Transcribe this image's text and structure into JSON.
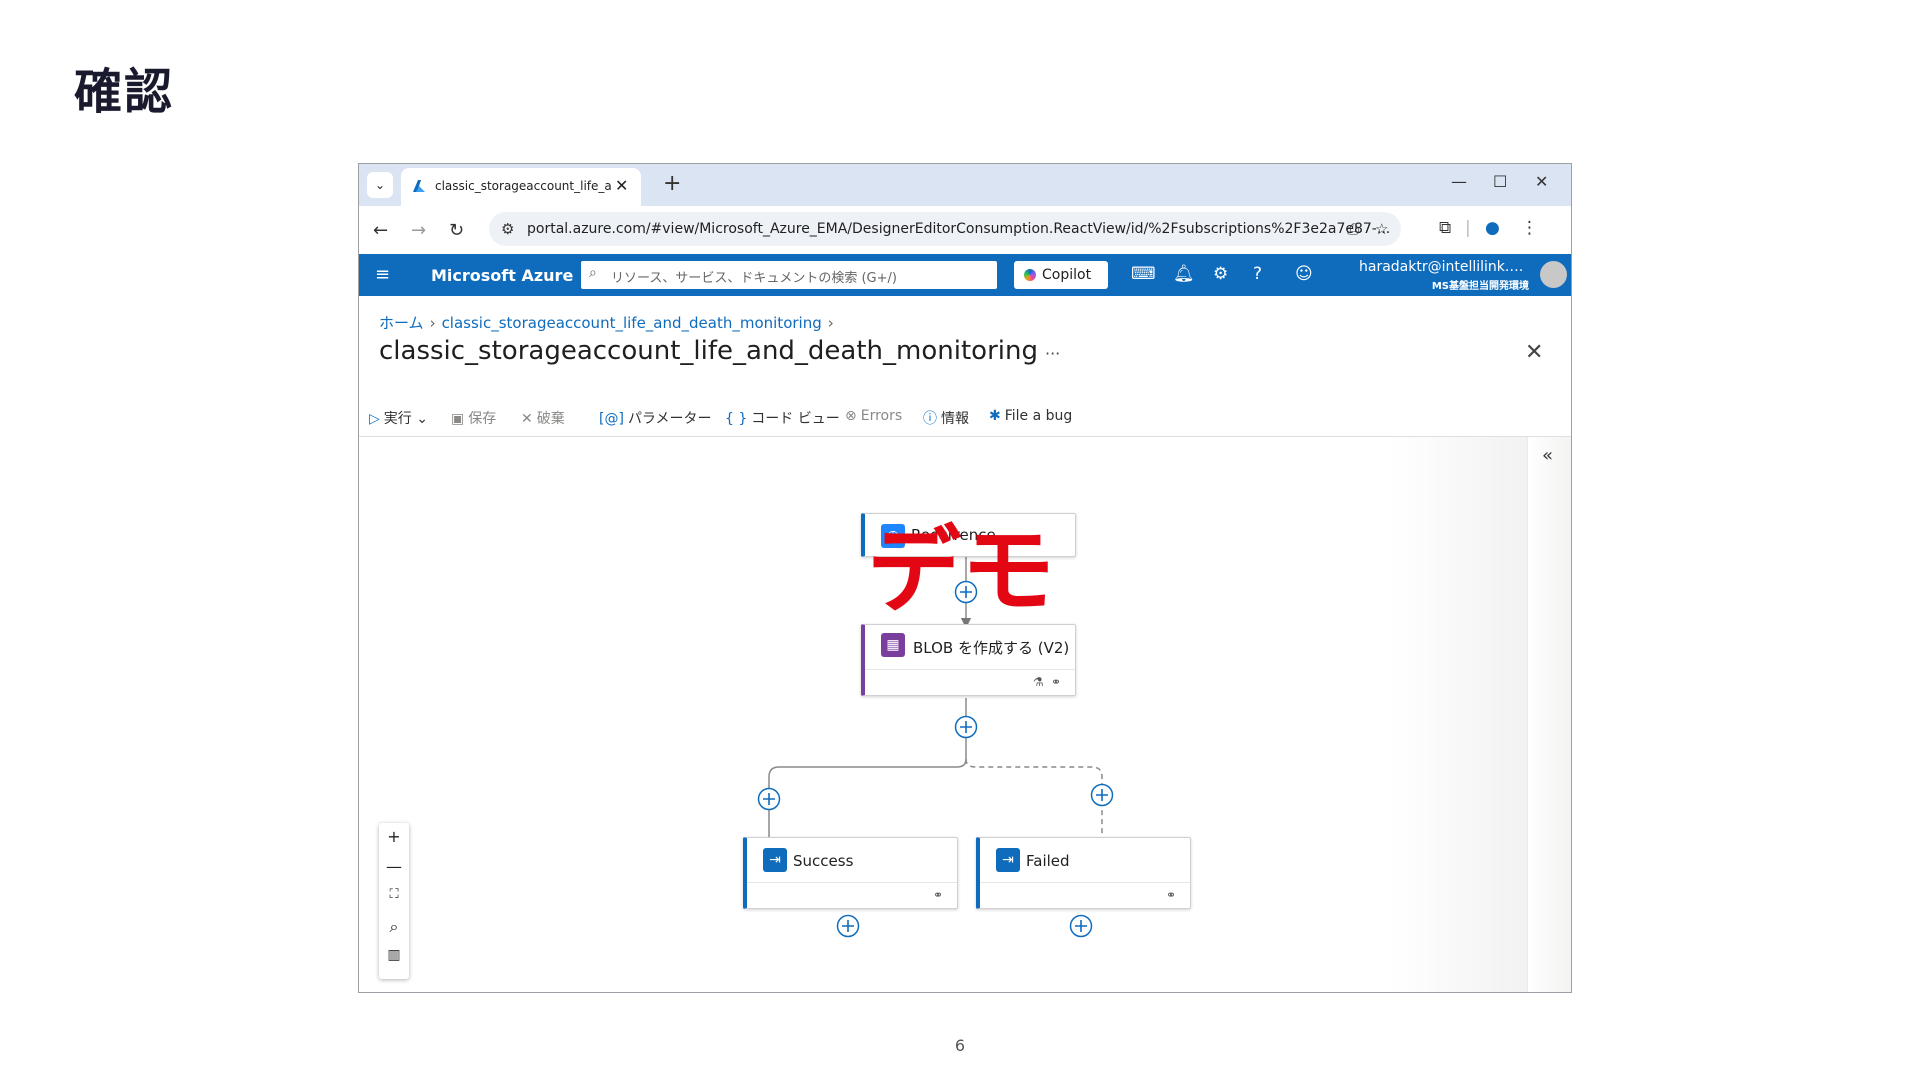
{
  "slide": {
    "title": "確認",
    "page_number": "6"
  },
  "browser": {
    "tab_title": "classic_storageaccount_life_and_death_monitoring",
    "tab_close": "✕",
    "new_tab": "+",
    "url": "portal.azure.com/#view/Microsoft_Azure_EMA/DesignerEditorConsumption.ReactView/id/%2Fsubscriptions%2F3e2a7e87-..."
  },
  "azure": {
    "brand": "Microsoft Azure",
    "search_placeholder": "リソース、サービス、ドキュメントの検索 (G+/)",
    "copilot": "Copilot",
    "user_name": "haradaktr@intellilink.…",
    "user_tenant": "MS基盤担当開発環境"
  },
  "breadcrumb": {
    "home": "ホーム",
    "resource": "classic_storageaccount_life_and_death_monitoring"
  },
  "page_title": "classic_storageaccount_life_and_death_monitoring",
  "more": "···",
  "commands": {
    "run": "実行",
    "save": "保存",
    "discard": "破棄",
    "parameters": "パラメーター",
    "code_view": "コード ビュー",
    "errors": "Errors",
    "info": "情報",
    "file_bug": "File a bug"
  },
  "workflow": {
    "trigger": "Recurrence",
    "action": "BLOB を作成する (V2)",
    "branch_success": "Success",
    "branch_failed": "Failed"
  },
  "overlay": {
    "stamp": "デモ"
  },
  "colors": {
    "azure_blue": "#0f6cbd",
    "blob_purple": "#7a3e9d",
    "stamp_red": "#e30613",
    "failed_dot": "#a4262c"
  },
  "icons": [
    "microsoft-azure-logo-icon",
    "back-arrow-icon",
    "forward-arrow-icon",
    "reload-icon",
    "site-info-icon",
    "install-app-icon",
    "bookmark-star-icon",
    "extensions-icon",
    "profile-icon",
    "browser-menu-icon",
    "hamburger-menu-icon",
    "search-icon",
    "cloud-shell-icon",
    "bell-icon",
    "gear-icon",
    "help-icon",
    "feedback-icon",
    "play-icon",
    "save-icon",
    "discard-icon",
    "parameters-icon",
    "code-braces-icon",
    "error-icon",
    "info-icon",
    "bug-icon",
    "collapse-chevrons-icon",
    "zoom-in-icon",
    "zoom-out-icon",
    "fit-view-icon",
    "zoom-search-icon",
    "minimap-icon"
  ]
}
